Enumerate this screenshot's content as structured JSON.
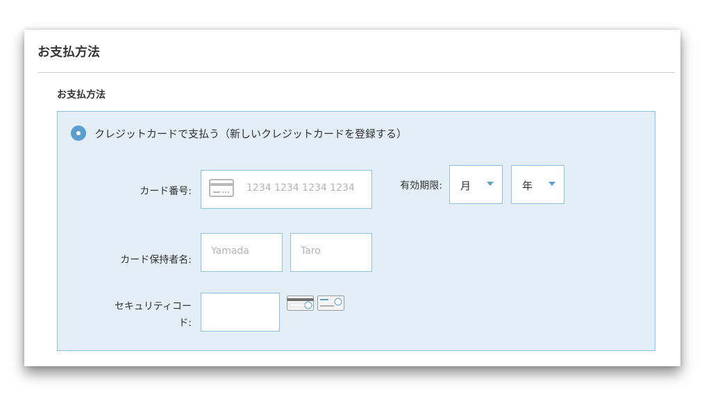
{
  "header": {
    "title": "お支払方法"
  },
  "section": {
    "title": "お支払方法"
  },
  "payment_option": {
    "label": "クレジットカードで支払う（新しいクレジットカードを登録する）",
    "selected": true
  },
  "card_number": {
    "label": "カード番号:",
    "placeholder": "1234 1234 1234 1234",
    "icon": "credit-card-icon"
  },
  "expiry": {
    "label": "有効期限:",
    "month": "月",
    "year": "年",
    "caret_icon": "caret-down-icon"
  },
  "card_holder": {
    "label": "カード保持者名:",
    "last_name_placeholder": "Yamada",
    "first_name_placeholder": "Taro"
  },
  "security_code": {
    "label_line1": "セキュリティコー",
    "label_line2": "ド:",
    "hint_icons": [
      "card-back-cvc-icon",
      "card-front-cvc-icon"
    ]
  },
  "colors": {
    "accent": "#5a9fcf",
    "panel_bg": "#e3eef6",
    "border": "#8fc0da",
    "text": "#333333",
    "placeholder": "#b4b4b4"
  }
}
